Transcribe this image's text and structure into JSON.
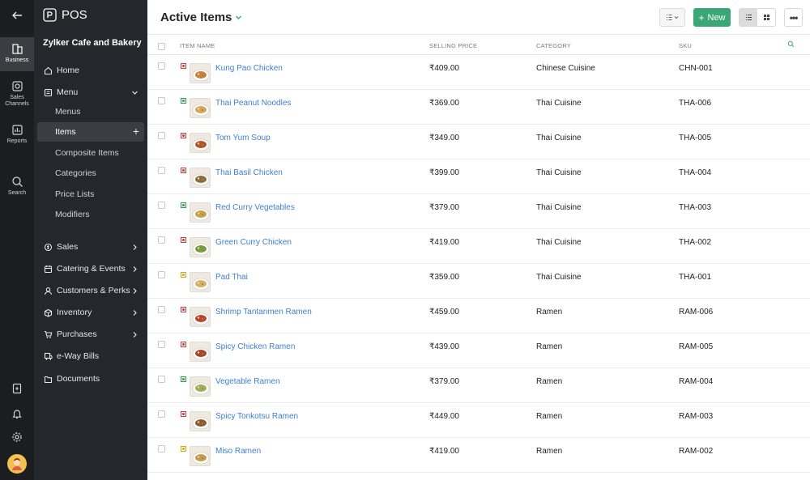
{
  "rail": {
    "items": [
      {
        "label": "Business",
        "icon": "business-icon"
      },
      {
        "label": "Sales Channels",
        "icon": "sales-channels-icon"
      },
      {
        "label": "Reports",
        "icon": "reports-icon"
      },
      {
        "label": "Search",
        "icon": "search-icon"
      }
    ]
  },
  "sidebar": {
    "app_name": "POS",
    "org_name": "Zylker Cafe and Bakery",
    "home": "Home",
    "menu": "Menu",
    "menu_children": [
      "Menus",
      "Items",
      "Composite Items",
      "Categories",
      "Price Lists",
      "Modifiers"
    ],
    "sections": [
      "Sales",
      "Catering & Events",
      "Customers & Perks",
      "Inventory",
      "Purchases",
      "e-Way Bills",
      "Documents"
    ]
  },
  "header": {
    "title": "Active Items",
    "new_label": "New"
  },
  "table": {
    "columns": {
      "name": "ITEM NAME",
      "price": "SELLING PRICE",
      "category": "CATEGORY",
      "sku": "SKU"
    },
    "rows": [
      {
        "name": "Kung Pao Chicken",
        "price": "₹409.00",
        "category": "Chinese Cuisine",
        "sku": "CHN-001",
        "type": "nonveg"
      },
      {
        "name": "Thai Peanut Noodles",
        "price": "₹369.00",
        "category": "Thai Cuisine",
        "sku": "THA-006",
        "type": "veg"
      },
      {
        "name": "Tom Yum Soup",
        "price": "₹349.00",
        "category": "Thai Cuisine",
        "sku": "THA-005",
        "type": "nonveg"
      },
      {
        "name": "Thai Basil Chicken",
        "price": "₹399.00",
        "category": "Thai Cuisine",
        "sku": "THA-004",
        "type": "nonveg"
      },
      {
        "name": "Red Curry Vegetables",
        "price": "₹379.00",
        "category": "Thai Cuisine",
        "sku": "THA-003",
        "type": "veg"
      },
      {
        "name": "Green Curry Chicken",
        "price": "₹419.00",
        "category": "Thai Cuisine",
        "sku": "THA-002",
        "type": "nonveg"
      },
      {
        "name": "Pad Thai",
        "price": "₹359.00",
        "category": "Thai Cuisine",
        "sku": "THA-001",
        "type": "egg"
      },
      {
        "name": "Shrimp Tantanmen Ramen",
        "price": "₹459.00",
        "category": "Ramen",
        "sku": "RAM-006",
        "type": "nonveg"
      },
      {
        "name": "Spicy Chicken Ramen",
        "price": "₹439.00",
        "category": "Ramen",
        "sku": "RAM-005",
        "type": "nonveg"
      },
      {
        "name": "Vegetable Ramen",
        "price": "₹379.00",
        "category": "Ramen",
        "sku": "RAM-004",
        "type": "veg"
      },
      {
        "name": "Spicy Tonkotsu Ramen",
        "price": "₹449.00",
        "category": "Ramen",
        "sku": "RAM-003",
        "type": "nonveg"
      },
      {
        "name": "Miso Ramen",
        "price": "₹419.00",
        "category": "Ramen",
        "sku": "RAM-002",
        "type": "egg"
      }
    ]
  },
  "colors": {
    "accent": "#3ba776",
    "link": "#3d7fd1",
    "veg": "#2e9e48",
    "nonveg": "#d23b3b",
    "egg": "#d9a514",
    "sidebar_bg": "#24272b",
    "rail_bg": "#1b1d20"
  }
}
